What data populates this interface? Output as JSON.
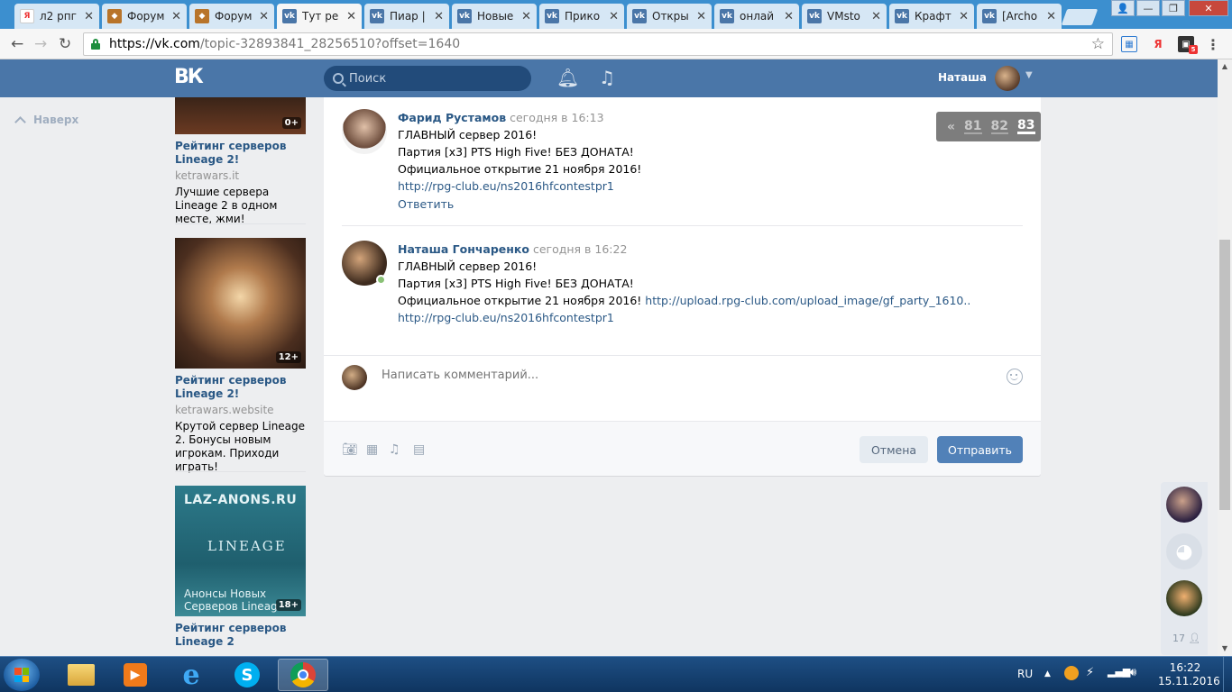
{
  "browser": {
    "tabs": [
      {
        "title": "л2 рпг",
        "fav": "Я",
        "fav_color": "#e33"
      },
      {
        "title": "Форум",
        "fav": "◆",
        "fav_color": "#b8742a"
      },
      {
        "title": "Форум",
        "fav": "◆",
        "fav_color": "#b8742a"
      },
      {
        "title": "Тут ре",
        "fav": "vk",
        "fav_color": "#4a76a8",
        "active": true
      },
      {
        "title": "Пиар |",
        "fav": "vk",
        "fav_color": "#4a76a8"
      },
      {
        "title": "Новые",
        "fav": "vk",
        "fav_color": "#4a76a8"
      },
      {
        "title": "Прико",
        "fav": "vk",
        "fav_color": "#4a76a8"
      },
      {
        "title": "Откры",
        "fav": "vk",
        "fav_color": "#4a76a8"
      },
      {
        "title": "онлай",
        "fav": "vk",
        "fav_color": "#4a76a8"
      },
      {
        "title": "VMsto",
        "fav": "vk",
        "fav_color": "#4a76a8"
      },
      {
        "title": "Крафт",
        "fav": "vk",
        "fav_color": "#4a76a8"
      },
      {
        "title": "[Archo",
        "fav": "vk",
        "fav_color": "#4a76a8"
      }
    ],
    "url_host": "https://vk.com",
    "url_rest": "/topic-32893841_28256510?offset=1640",
    "ext_badge": "5"
  },
  "vk": {
    "search_placeholder": "Поиск",
    "user_name": "Наташа",
    "up_label": "Наверх"
  },
  "ads": [
    {
      "title": "Рейтинг серверов Lineage 2!",
      "domain": "ketrawars.it",
      "text": "Лучшие сервера Lineage 2 в одном месте, жми!",
      "age": "0+"
    },
    {
      "title": "Рейтинг серверов Lineage 2!",
      "domain": "ketrawars.website",
      "text": "Крутой сервер Lineage 2. Бонусы новым игрокам. Приходи играть!",
      "age": "12+"
    },
    {
      "title": "Рейтинг серверов Lineage 2",
      "domain": "",
      "text": "",
      "age": "18+",
      "img_top_text": "LAZ-ANONS.RU",
      "img_logo": "LINEAGE",
      "img_bottom_text": "Анонсы Новых Серверов Lineag"
    }
  ],
  "pager": {
    "prev": "«",
    "pages": [
      "81",
      "82",
      "83"
    ],
    "current": "83"
  },
  "posts": [
    {
      "author": "Фарид Рустамов",
      "time": "сегодня в 16:13",
      "lines": [
        "ГЛАВНЫЙ сервер 2016!",
        "Партия [x3] PTS High Five! БЕЗ ДОНАТА!",
        "Официальное открытие 21 ноября 2016!"
      ],
      "link": "http://rpg-club.eu/ns2016hfcontestpr1",
      "reply": "Ответить"
    },
    {
      "author": "Наташа Гончаренко",
      "time": "сегодня в 16:22",
      "lines": [
        "ГЛАВНЫЙ сервер 2016!",
        "Партия [x3] PTS High Five! БЕЗ ДОНАТА!",
        "Официальное открытие 21 ноября 2016!"
      ],
      "inline_link": "http://upload.rpg-club.com/upload_image/gf_party_1610..",
      "link": "http://rpg-club.eu/ns2016hfcontestpr1"
    }
  ],
  "comment": {
    "placeholder": "Написать комментарий...",
    "cancel": "Отмена",
    "send": "Отправить"
  },
  "rightbar": {
    "count": "17"
  },
  "taskbar": {
    "lang": "RU",
    "time": "16:22",
    "date": "15.11.2016"
  }
}
